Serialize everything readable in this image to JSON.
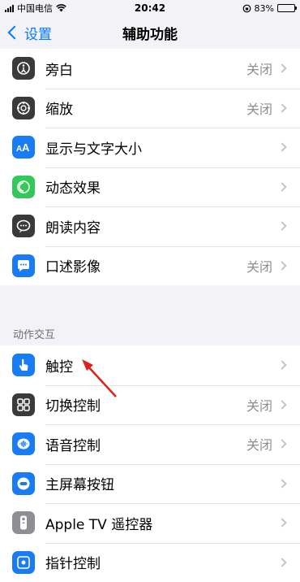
{
  "status_bar": {
    "carrier": "中国电信",
    "time": "20:42",
    "battery": "83%",
    "battery_level": 0.83
  },
  "nav": {
    "back_label": "设置",
    "title": "辅助功能"
  },
  "group1": [
    {
      "label": "旁白",
      "value": "关闭",
      "icon": "voiceover-icon",
      "color": "#3a3a3c"
    },
    {
      "label": "缩放",
      "value": "关闭",
      "icon": "zoom-icon",
      "color": "#3a3a3c"
    },
    {
      "label": "显示与文字大小",
      "value": "",
      "icon": "text-size-icon",
      "color": "#1a7cf5"
    },
    {
      "label": "动态效果",
      "value": "",
      "icon": "motion-icon",
      "color": "#34c759"
    },
    {
      "label": "朗读内容",
      "value": "",
      "icon": "spoken-content-icon",
      "color": "#3a3a3c"
    },
    {
      "label": "口述影像",
      "value": "关闭",
      "icon": "audio-description-icon",
      "color": "#1a7cf5"
    }
  ],
  "section2_header": "动作交互",
  "group2": [
    {
      "label": "触控",
      "value": "",
      "icon": "touch-icon",
      "color": "#1a7cf5"
    },
    {
      "label": "切换控制",
      "value": "关闭",
      "icon": "switch-control-icon",
      "color": "#3a3a3c"
    },
    {
      "label": "语音控制",
      "value": "关闭",
      "icon": "voice-control-icon",
      "color": "#1a7cf5"
    },
    {
      "label": "主屏幕按钮",
      "value": "",
      "icon": "home-button-icon",
      "color": "#1a7cf5"
    },
    {
      "label": "Apple TV 遥控器",
      "value": "",
      "icon": "tv-remote-icon",
      "color": "#8e8e93"
    },
    {
      "label": "指针控制",
      "value": "",
      "icon": "pointer-control-icon",
      "color": "#1a7cf5"
    }
  ],
  "annotation": {
    "color": "#e0201b"
  }
}
